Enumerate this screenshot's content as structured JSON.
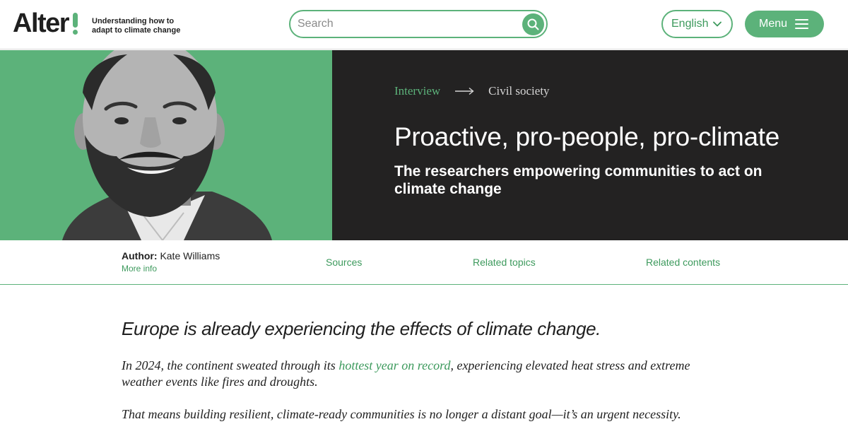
{
  "header": {
    "logo_text": "Alter",
    "tagline": "Understanding how to adapt to climate change",
    "search_placeholder": "Search",
    "language": "English",
    "menu_label": "Menu"
  },
  "hero": {
    "breadcrumb": [
      "Interview",
      "Civil society"
    ],
    "title": "Proactive, pro-people, pro-climate",
    "subtitle": "The researchers empowering communities to act on climate change"
  },
  "info_bar": {
    "author_label": "Author:",
    "author_name": "Kate Williams",
    "more_info": "More info",
    "links": [
      "Sources",
      "Related topics",
      "Related contents"
    ]
  },
  "article": {
    "lead": "Europe is already experiencing the effects of climate change.",
    "p1_before": "In 2024, the continent sweated through its ",
    "p1_link": "hottest year on record",
    "p1_after": ", experiencing elevated heat stress and extreme weather events like fires and droughts.",
    "p2": "That means building resilient, climate-ready communities is no longer a distant goal—it’s an urgent necessity."
  },
  "colors": {
    "accent": "#5cb27a",
    "accent_text": "#3d9a5d",
    "hero_dark": "#232222"
  },
  "icons": [
    "search-icon",
    "chevron-down-icon",
    "hamburger-icon",
    "arrow-right-icon"
  ]
}
